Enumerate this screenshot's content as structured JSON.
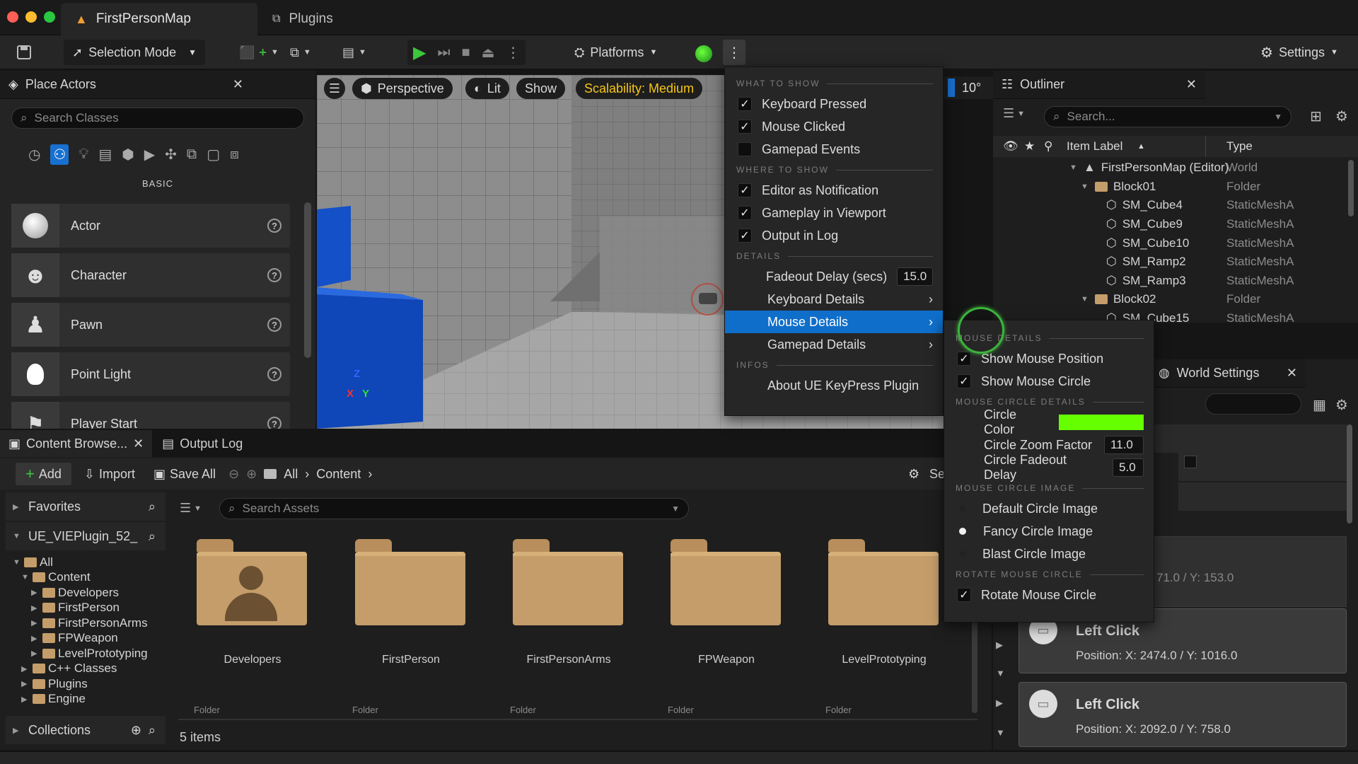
{
  "title_bar": {
    "tabs": [
      {
        "label": "FirstPersonMap"
      },
      {
        "label": "Plugins"
      }
    ]
  },
  "toolbar": {
    "selection_mode": "Selection Mode",
    "platforms": "Platforms",
    "settings": "Settings"
  },
  "place_actors": {
    "title": "Place Actors",
    "search_placeholder": "Search Classes",
    "category": "BASIC",
    "items": [
      {
        "label": "Actor"
      },
      {
        "label": "Character"
      },
      {
        "label": "Pawn"
      },
      {
        "label": "Point Light"
      },
      {
        "label": "Player Start"
      }
    ]
  },
  "viewport": {
    "perspective": "Perspective",
    "lit": "Lit",
    "show": "Show",
    "scalability": "Scalability: Medium",
    "angle": "10°",
    "axis_z": "Z",
    "axis_x": "X",
    "axis_y": "Y"
  },
  "main_menu": {
    "section_what": "WHAT TO SHOW",
    "keyboard_pressed": "Keyboard Pressed",
    "mouse_clicked": "Mouse Clicked",
    "gamepad_events": "Gamepad Events",
    "section_where": "WHERE TO SHOW",
    "editor_notification": "Editor as Notification",
    "gameplay_viewport": "Gameplay in Viewport",
    "output_log": "Output in Log",
    "section_details": "DETAILS",
    "fadeout_label": "Fadeout Delay (secs)",
    "fadeout_value": "15.0",
    "keyboard_details": "Keyboard Details",
    "mouse_details": "Mouse Details",
    "gamepad_details": "Gamepad Details",
    "section_infos": "INFOS",
    "about": "About UE KeyPress Plugin"
  },
  "sub_menu": {
    "section_mouse": "MOUSE DETAILS",
    "show_position": "Show Mouse Position",
    "show_circle": "Show Mouse Circle",
    "section_circle": "MOUSE CIRCLE DETAILS",
    "circle_color_label": "Circle Color",
    "circle_color": "#66ff00",
    "zoom_label": "Circle Zoom Factor",
    "zoom_value": "11.0",
    "fade_label": "Circle Fadeout Delay",
    "fade_value": "5.0",
    "section_image": "MOUSE CIRCLE IMAGE",
    "img_default": "Default Circle Image",
    "img_fancy": "Fancy Circle Image",
    "img_blast": "Blast Circle Image",
    "section_rotate": "ROTATE MOUSE CIRCLE",
    "rotate": "Rotate Mouse Circle"
  },
  "outliner": {
    "title": "Outliner",
    "search_placeholder": "Search...",
    "col_label": "Item Label",
    "col_type": "Type",
    "rows": [
      {
        "label": "FirstPersonMap (Editor)",
        "type": "World"
      },
      {
        "label": "Block01",
        "type": "Folder"
      },
      {
        "label": "SM_Cube4",
        "type": "StaticMeshA"
      },
      {
        "label": "SM_Cube9",
        "type": "StaticMeshA"
      },
      {
        "label": "SM_Cube10",
        "type": "StaticMeshA"
      },
      {
        "label": "SM_Ramp2",
        "type": "StaticMeshA"
      },
      {
        "label": "SM_Ramp3",
        "type": "StaticMeshA"
      },
      {
        "label": "Block02",
        "type": "Folder"
      },
      {
        "label": "SM_Cube15",
        "type": "StaticMeshA"
      }
    ]
  },
  "world_settings": {
    "title": "World Settings",
    "partial_position": "71.0 / Y: 153.0"
  },
  "notifications": [
    {
      "title": "Left Click",
      "position": "Position: X: 2474.0 / Y: 1016.0"
    },
    {
      "title": "Left Click",
      "position": "Position: X: 2092.0 / Y: 758.0"
    }
  ],
  "content_browser": {
    "tab_content": "Content Browse...",
    "tab_output": "Output Log",
    "add": "Add",
    "import": "Import",
    "save_all": "Save All",
    "crumb_all": "All",
    "crumb_content": "Content",
    "settings_partial": "Se",
    "favorites": "Favorites",
    "project": "UE_VIEPlugin_52_",
    "search_placeholder": "Search Assets",
    "tree": {
      "all": "All",
      "content": "Content",
      "developers": "Developers",
      "firstperson": "FirstPerson",
      "firstpersonarms": "FirstPersonArms",
      "fpweapon": "FPWeapon",
      "levelprototyping": "LevelPrototyping",
      "cpp": "C++ Classes",
      "plugins": "Plugins",
      "engine": "Engine"
    },
    "folders": [
      {
        "label": "Developers",
        "type": "Folder"
      },
      {
        "label": "FirstPerson",
        "type": "Folder"
      },
      {
        "label": "FirstPersonArms",
        "type": "Folder"
      },
      {
        "label": "FPWeapon",
        "type": "Folder"
      },
      {
        "label": "LevelPrototyping",
        "type": "Folder"
      }
    ],
    "collections": "Collections",
    "item_count": "5 items"
  }
}
